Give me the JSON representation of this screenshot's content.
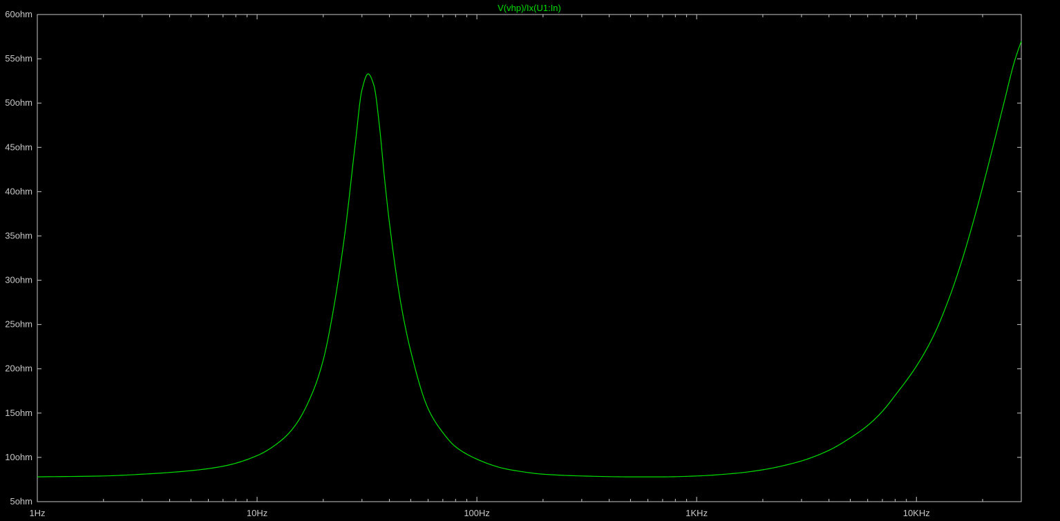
{
  "trace_label": "V(vhp)/Ix(U1:In)",
  "colors": {
    "background": "#000000",
    "frame": "#c8c8c8",
    "trace": "#00e000",
    "tick_text": "#c8c8c8"
  },
  "chart_data": {
    "type": "line",
    "xscale": "log",
    "xlim": [
      1,
      30000
    ],
    "ylim": [
      5,
      60
    ],
    "grid": false,
    "xticks": [
      {
        "value": 1,
        "label": "1Hz"
      },
      {
        "value": 10,
        "label": "10Hz"
      },
      {
        "value": 100,
        "label": "100Hz"
      },
      {
        "value": 1000,
        "label": "1KHz"
      },
      {
        "value": 10000,
        "label": "10KHz"
      }
    ],
    "yticks": [
      {
        "value": 5,
        "label": "5ohm"
      },
      {
        "value": 10,
        "label": "10ohm"
      },
      {
        "value": 15,
        "label": "15ohm"
      },
      {
        "value": 20,
        "label": "20ohm"
      },
      {
        "value": 25,
        "label": "25ohm"
      },
      {
        "value": 30,
        "label": "30ohm"
      },
      {
        "value": 35,
        "label": "35ohm"
      },
      {
        "value": 40,
        "label": "40ohm"
      },
      {
        "value": 45,
        "label": "45ohm"
      },
      {
        "value": 50,
        "label": "50ohm"
      },
      {
        "value": 55,
        "label": "55ohm"
      },
      {
        "value": 60,
        "label": "60ohm"
      }
    ],
    "series": [
      {
        "name": "V(vhp)/Ix(U1:In)",
        "x": [
          1,
          2,
          3,
          5,
          7,
          10,
          13,
          15,
          18,
          20,
          22,
          25,
          28,
          30,
          32,
          34,
          36,
          38,
          40,
          45,
          50,
          60,
          70,
          80,
          100,
          130,
          150,
          200,
          300,
          500,
          700,
          1000,
          1500,
          2000,
          3000,
          4000,
          5000,
          6000,
          7000,
          8000,
          10000,
          12000,
          14000,
          16000,
          18000,
          20000,
          22000,
          25000,
          28000,
          30000
        ],
        "y": [
          7.8,
          7.9,
          8.1,
          8.5,
          9.0,
          10.2,
          12.0,
          13.7,
          17.5,
          21.0,
          26.0,
          35.0,
          45.5,
          51.5,
          53.3,
          52.0,
          47.5,
          41.5,
          36.5,
          27.5,
          22.0,
          15.5,
          12.8,
          11.2,
          9.8,
          8.8,
          8.5,
          8.1,
          7.9,
          7.8,
          7.8,
          7.9,
          8.2,
          8.6,
          9.6,
          10.8,
          12.2,
          13.6,
          15.2,
          17.0,
          20.3,
          23.8,
          27.8,
          32.0,
          36.3,
          40.5,
          44.5,
          50.0,
          54.8,
          57.0
        ]
      }
    ]
  }
}
